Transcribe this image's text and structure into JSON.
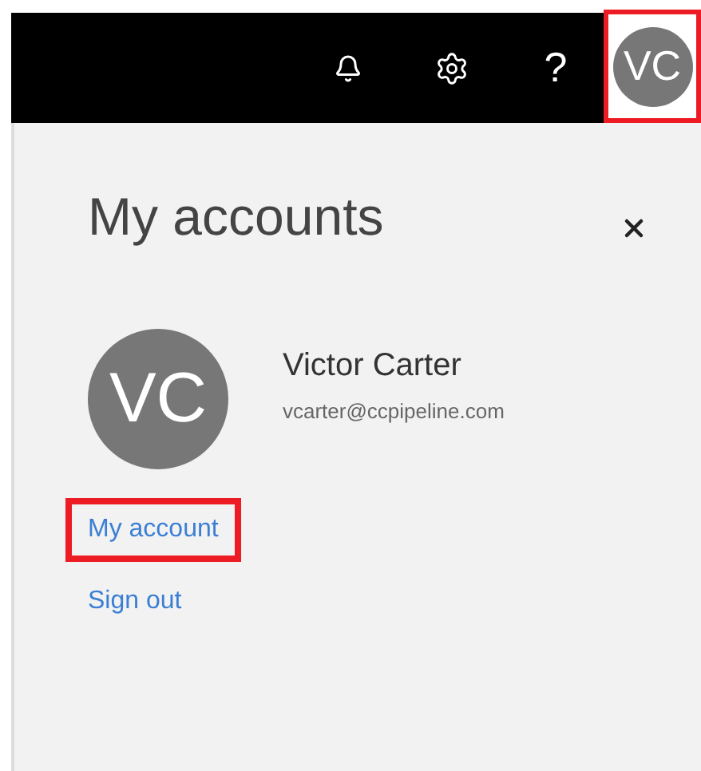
{
  "top_bar": {
    "help_glyph": "?",
    "avatar": {
      "initials": "VC",
      "highlighted": true
    }
  },
  "panel": {
    "title": "My accounts",
    "account": {
      "initials": "VC",
      "name": "Victor Carter",
      "email": "vcarter@ccpipeline.com"
    },
    "links": [
      {
        "label": "My account",
        "highlighted": true
      },
      {
        "label": "Sign out",
        "highlighted": false
      }
    ]
  }
}
